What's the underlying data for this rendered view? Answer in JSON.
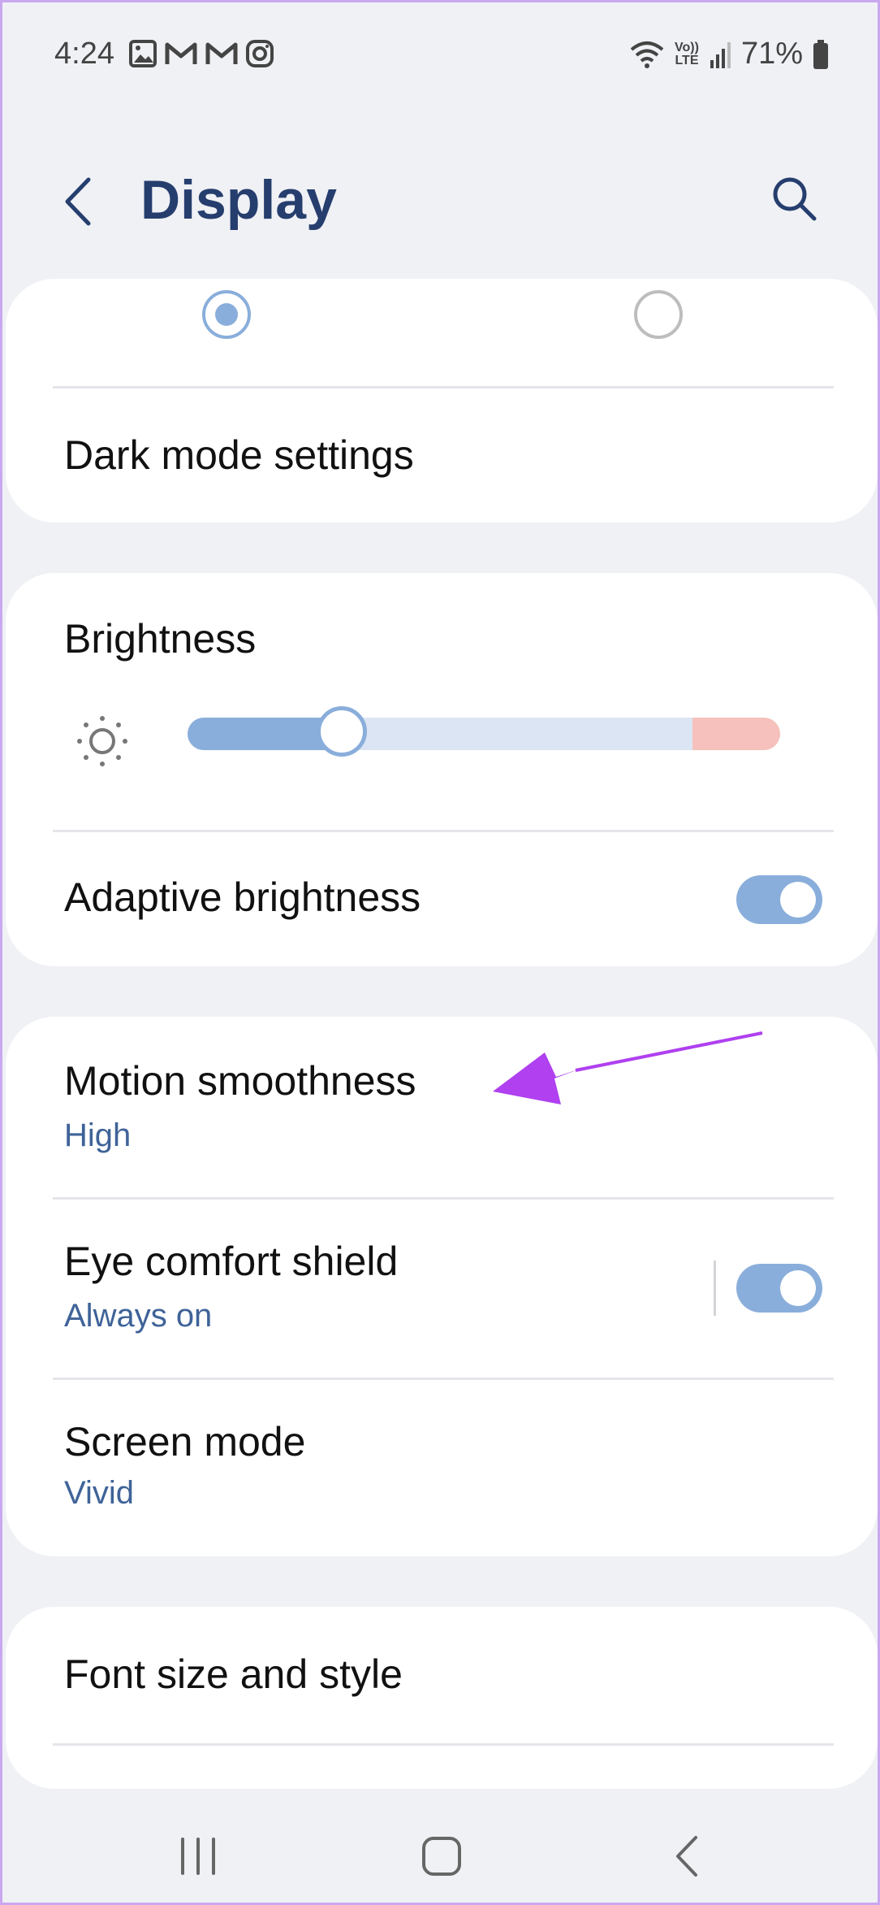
{
  "status": {
    "time": "4:24",
    "left_icons": [
      "gallery-icon",
      "gmail-icon",
      "gmail-icon",
      "instagram-icon"
    ],
    "lte_top": "Vo))",
    "lte_bottom": "LTE",
    "battery_percent": "71%"
  },
  "header": {
    "title": "Display"
  },
  "theme_card": {
    "light_selected": true,
    "dark_mode_settings_label": "Dark mode settings"
  },
  "brightness_card": {
    "title": "Brightness",
    "brightness_level": 0.26,
    "adaptive_label": "Adaptive brightness",
    "adaptive_on": true
  },
  "display_card": {
    "motion_title": "Motion smoothness",
    "motion_value": "High",
    "eye_title": "Eye comfort shield",
    "eye_value": "Always on",
    "eye_on": true,
    "screen_mode_title": "Screen mode",
    "screen_mode_value": "Vivid"
  },
  "font_card": {
    "title": "Font size and style"
  },
  "colors": {
    "accent": "#8aaedb",
    "subtitle": "#3f6398",
    "title": "#263e6e",
    "annotation_arrow": "#b040f0"
  }
}
